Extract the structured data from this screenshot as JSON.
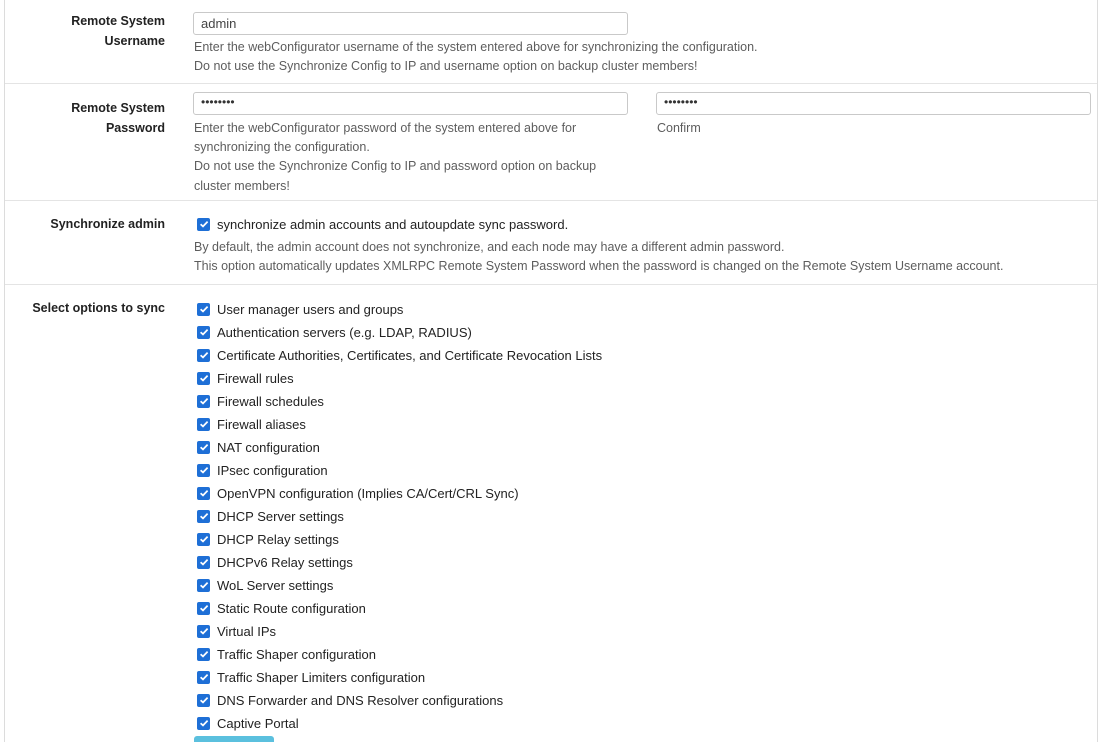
{
  "username": {
    "label_line1": "Remote System",
    "label_line2": "Username",
    "value": "admin",
    "help_line1": "Enter the webConfigurator username of the system entered above for synchronizing the configuration.",
    "help_line2": "Do not use the Synchronize Config to IP and username option on backup cluster members!"
  },
  "password": {
    "label_line1": "Remote System",
    "label_line2": "Password",
    "value_mask": "••••••••",
    "confirm_mask": "••••••••",
    "help_line1": "Enter the webConfigurator password of the system entered above for",
    "help_line2": "synchronizing the configuration.",
    "help_line3": "Do not use the Synchronize Config to IP and password option on backup",
    "help_line4": "cluster members!",
    "confirm_label": "Confirm"
  },
  "sync_admin": {
    "label": "Synchronize admin",
    "checkbox_label": "synchronize admin accounts and autoupdate sync password.",
    "checked": true,
    "help_line1": "By default, the admin account does not synchronize, and each node may have a different admin password.",
    "help_line2": "This option automatically updates XMLRPC Remote System Password when the password is changed on the Remote System Username account."
  },
  "sync_options": {
    "label": "Select options to sync",
    "items": [
      {
        "label": "User manager users and groups",
        "checked": true
      },
      {
        "label": "Authentication servers (e.g. LDAP, RADIUS)",
        "checked": true
      },
      {
        "label": "Certificate Authorities, Certificates, and Certificate Revocation Lists",
        "checked": true
      },
      {
        "label": "Firewall rules",
        "checked": true
      },
      {
        "label": "Firewall schedules",
        "checked": true
      },
      {
        "label": "Firewall aliases",
        "checked": true
      },
      {
        "label": "NAT configuration",
        "checked": true
      },
      {
        "label": "IPsec configuration",
        "checked": true
      },
      {
        "label": "OpenVPN configuration (Implies CA/Cert/CRL Sync)",
        "checked": true
      },
      {
        "label": "DHCP Server settings",
        "checked": true
      },
      {
        "label": "DHCP Relay settings",
        "checked": true
      },
      {
        "label": "DHCPv6 Relay settings",
        "checked": true
      },
      {
        "label": "WoL Server settings",
        "checked": true
      },
      {
        "label": "Static Route configuration",
        "checked": true
      },
      {
        "label": "Virtual IPs",
        "checked": true
      },
      {
        "label": "Traffic Shaper configuration",
        "checked": true
      },
      {
        "label": "Traffic Shaper Limiters configuration",
        "checked": true
      },
      {
        "label": "DNS Forwarder and DNS Resolver configurations",
        "checked": true
      },
      {
        "label": "Captive Portal",
        "checked": true
      }
    ]
  },
  "colors": {
    "checkbox": "#1e6fd6",
    "button": "#5bc0de"
  }
}
